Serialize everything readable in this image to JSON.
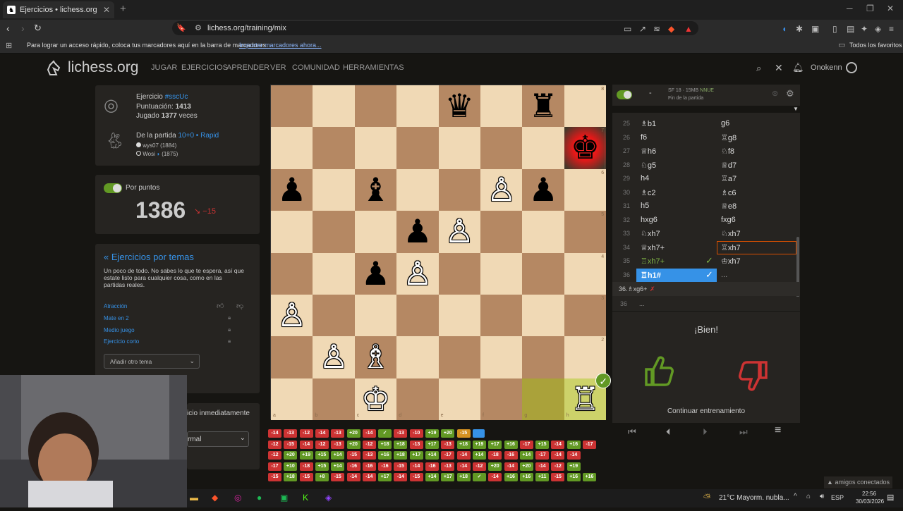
{
  "browser": {
    "tab_title": "Ejercicios • lichess.org",
    "url": "lichess.org/training/mix",
    "bookmark_hint": "Para lograr un acceso rápido, coloca tus marcadores aquí en la barra de marcadores.",
    "bookmark_import": "Importar marcadores ahora...",
    "bookmark_all": "Todos los favoritos"
  },
  "site": {
    "logo": "lichess.org",
    "nav": [
      "JUGAR",
      "EJERCICIOS",
      "APRENDER",
      "VER",
      "COMUNIDAD",
      "HERRAMIENTAS"
    ],
    "user": "Onokenn"
  },
  "puzzle": {
    "label": "Ejercicio",
    "id": "#sscUc",
    "rating_label": "Puntuación:",
    "rating": "1413",
    "played_label": "Jugado",
    "played": "1377",
    "played_suffix": "veces",
    "from_game": "De la partida",
    "game_type": "10+0",
    "game_mode": "Rapid",
    "white": "wys07 (1884)",
    "black": "Wosi",
    "black_rating": "(1875)"
  },
  "score": {
    "toggle_label": "Por puntos",
    "rating": "1386",
    "delta": "−15"
  },
  "themes": {
    "title": "« Ejercicios por temas",
    "desc": "Un poco de todo. No sabes lo que te espera, así que estate listo para cualquier cosa, como en las partidas reales.",
    "items": [
      "Atracción",
      "Mate en 2",
      "Medio juego",
      "Ejercicio corto"
    ],
    "select": "Añadir otro tema",
    "partial": "icio inmediatamente",
    "partial2": "rmal"
  },
  "engine": {
    "name": "SF 18 · 15MB",
    "tag": "NNUE",
    "status": "Fin de la partida",
    "dash": "-"
  },
  "moves": [
    {
      "n": "25",
      "w": "♗b1",
      "b": "g6"
    },
    {
      "n": "26",
      "w": "f6",
      "b": "♖g8"
    },
    {
      "n": "27",
      "w": "♕h6",
      "b": "♘f8"
    },
    {
      "n": "28",
      "w": "♘g5",
      "b": "♕d7"
    },
    {
      "n": "29",
      "w": "h4",
      "b": "♖a7"
    },
    {
      "n": "30",
      "w": "♗c2",
      "b": "♗c6"
    },
    {
      "n": "31",
      "w": "h5",
      "b": "♕e8"
    },
    {
      "n": "32",
      "w": "hxg6",
      "b": "fxg6"
    },
    {
      "n": "33",
      "w": "♘xh7",
      "b": "♘xh7"
    },
    {
      "n": "34",
      "w": "♕xh7+",
      "b": "♖xh7"
    },
    {
      "n": "35",
      "w": "♖xh7+",
      "b": "♔xh7"
    },
    {
      "n": "36",
      "w": "♖h1#",
      "b": "..."
    }
  ],
  "variation": {
    "text": "36.♗xg6+",
    "mark": "✗",
    "n": "36",
    "dots": "..."
  },
  "feedback": {
    "text": "¡Bien!",
    "continue": "Continuar entrenamiento"
  },
  "progress": [
    [
      "-14",
      "-13",
      "-12",
      "-14",
      "-13",
      "+20",
      "-14",
      "✓",
      "-13",
      "-10",
      "+19",
      "+20",
      "-15",
      ""
    ],
    [
      "-12",
      "-15",
      "-14",
      "-12",
      "-13",
      "+20",
      "-12",
      "+18",
      "+18",
      "-13",
      "+17",
      "-13",
      "+18",
      "+19",
      "+17",
      "+16",
      "-17",
      "+15",
      "-14",
      "+16",
      "-17"
    ],
    [
      "-12",
      "+20",
      "+19",
      "+15",
      "+14",
      "-15",
      "-13",
      "+16",
      "+18",
      "+17",
      "+14",
      "-17",
      "-14",
      "+14",
      "-18",
      "-16",
      "+14",
      "-17",
      "-14",
      "-14"
    ],
    [
      "-17",
      "+10",
      "-18",
      "+15",
      "+14",
      "-16",
      "-16",
      "-16",
      "-15",
      "-14",
      "-16",
      "-13",
      "-14",
      "-12",
      "+20",
      "-14",
      "+20",
      "-14",
      "-12",
      "+19"
    ],
    [
      "-15",
      "+18",
      "-15",
      "+8",
      "-15",
      "-14",
      "-14",
      "+17",
      "-14",
      "-15",
      "+14",
      "+17",
      "+18",
      "✓",
      "-14",
      "+16",
      "+16",
      "+11",
      "-15",
      "+16",
      "+16"
    ]
  ],
  "progress_colors": [
    [
      "r",
      "r",
      "r",
      "r",
      "r",
      "g",
      "r",
      "g",
      "r",
      "r",
      "g",
      "g",
      "o",
      "b"
    ],
    [
      "r",
      "r",
      "r",
      "r",
      "r",
      "g",
      "r",
      "g",
      "g",
      "r",
      "g",
      "r",
      "g",
      "g",
      "g",
      "g",
      "r",
      "g",
      "r",
      "g",
      "r"
    ],
    [
      "r",
      "g",
      "g",
      "g",
      "g",
      "r",
      "r",
      "g",
      "g",
      "g",
      "g",
      "r",
      "r",
      "g",
      "r",
      "r",
      "g",
      "r",
      "r",
      "r"
    ],
    [
      "r",
      "g",
      "r",
      "g",
      "g",
      "r",
      "r",
      "r",
      "r",
      "r",
      "r",
      "r",
      "r",
      "r",
      "g",
      "r",
      "g",
      "r",
      "r",
      "g"
    ],
    [
      "r",
      "g",
      "r",
      "g",
      "r",
      "r",
      "r",
      "g",
      "r",
      "r",
      "g",
      "g",
      "g",
      "g",
      "r",
      "g",
      "g",
      "g",
      "r",
      "g",
      "g"
    ]
  ],
  "taskbar": {
    "weather": "21°C  Mayorm. nubla...",
    "lang": "ESP",
    "time": "22:56",
    "date": "30/03/2026",
    "amigos": "amigos conectados"
  },
  "board_ranks": [
    "8",
    "7",
    "6",
    "5",
    "4",
    "3",
    "2",
    "1"
  ],
  "board_files": [
    "a",
    "b",
    "c",
    "d",
    "e",
    "f",
    "g",
    "h"
  ]
}
